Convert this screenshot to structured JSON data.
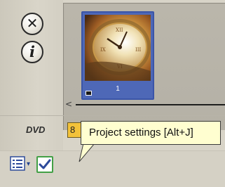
{
  "buttons": {
    "close_icon": "close-circle-icon",
    "info_icon": "info-circle-icon"
  },
  "storyboard": {
    "clips": [
      {
        "label": "1",
        "thumbnail": "clock-face-thumbnail"
      }
    ]
  },
  "status": {
    "disc_type": "DVD",
    "capacity_value": "8"
  },
  "toolbar": {
    "menu_icon": "list-menu-icon",
    "settings_icon": "checkmark-settings-icon"
  },
  "tooltip": {
    "text": "Project settings [Alt+J]"
  },
  "colors": {
    "selection_blue": "#4e68b7",
    "tooltip_bg": "#fffed0",
    "capacity_yellow": "#f3c23a",
    "settings_green": "#43a046"
  }
}
